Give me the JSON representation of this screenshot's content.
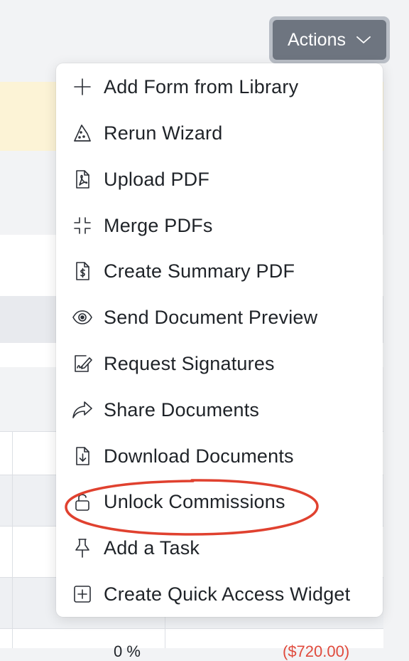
{
  "actions_button": {
    "label": "Actions",
    "icon": "chevron-down-icon"
  },
  "menu": {
    "items": [
      {
        "label": "Add Form from Library",
        "icon": "plus-icon"
      },
      {
        "label": "Rerun Wizard",
        "icon": "wizard-hat-icon"
      },
      {
        "label": "Upload PDF",
        "icon": "pdf-file-icon"
      },
      {
        "label": "Merge PDFs",
        "icon": "merge-icon"
      },
      {
        "label": "Create Summary PDF",
        "icon": "dollar-document-icon"
      },
      {
        "label": "Send Document Preview",
        "icon": "eye-icon"
      },
      {
        "label": "Request Signatures",
        "icon": "signature-icon"
      },
      {
        "label": "Share Documents",
        "icon": "share-arrow-icon"
      },
      {
        "label": "Download Documents",
        "icon": "download-document-icon"
      },
      {
        "label": "Unlock Commissions",
        "icon": "unlock-icon"
      },
      {
        "label": "Add a Task",
        "icon": "pin-icon"
      },
      {
        "label": "Create Quick Access Widget",
        "icon": "plus-square-icon"
      }
    ]
  },
  "annotation": {
    "highlighted_item": "Unlock Commissions",
    "color": "#e0412f"
  },
  "background": {
    "table_partial_values": [
      "0 %",
      "($720.00)"
    ],
    "negative_value_color": "#e04a3c"
  },
  "colors": {
    "button_bg": "#6e7580",
    "button_ring": "#b9bec6",
    "banner": "#fcf3d6",
    "page_bg": "#f2f3f5"
  }
}
